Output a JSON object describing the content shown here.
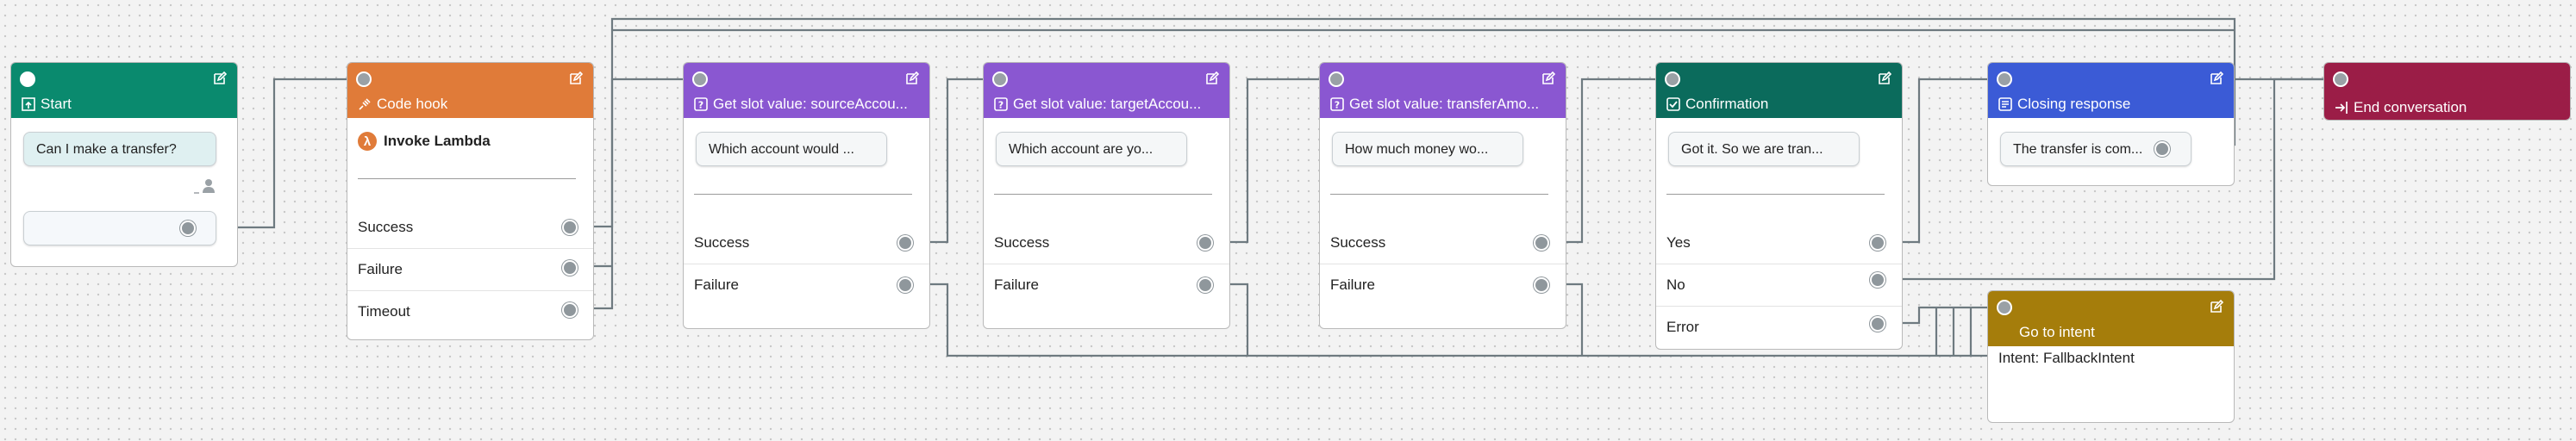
{
  "colors": {
    "start": "#0a8a6e",
    "codehook": "#e07b39",
    "slot": "#8a57d1",
    "confirmation": "#0b6b5c",
    "closing": "#3b5bd6",
    "end": "#9b1d47",
    "gotointent": "#a57d0b",
    "connector": "#6e7a80",
    "port": "#8f979c"
  },
  "start": {
    "title": "Start",
    "message": "Can I make a transfer?",
    "input_value": ""
  },
  "codehook": {
    "title": "Code hook",
    "lambda_label": "Invoke Lambda",
    "outputs": [
      "Success",
      "Failure",
      "Timeout"
    ]
  },
  "slot1": {
    "title": "Get slot value: sourceAccou...",
    "prompt": "Which account would ...",
    "outputs": [
      "Success",
      "Failure"
    ]
  },
  "slot2": {
    "title": "Get slot value: targetAccou...",
    "prompt": "Which account are yo...",
    "outputs": [
      "Success",
      "Failure"
    ]
  },
  "slot3": {
    "title": "Get slot value: transferAmo...",
    "prompt": "How much money wo...",
    "outputs": [
      "Success",
      "Failure"
    ]
  },
  "confirmation": {
    "title": "Confirmation",
    "prompt": "Got it. So we are tran...",
    "outputs": [
      "Yes",
      "No",
      "Error"
    ]
  },
  "closing": {
    "title": "Closing response",
    "prompt": "The transfer is com..."
  },
  "end": {
    "title": "End conversation"
  },
  "gotointent": {
    "title": "Go to intent",
    "intent_label": "Intent: FallbackIntent"
  },
  "icons": {
    "edit": "edit-icon",
    "start": "start-icon",
    "codehook": "plug-icon",
    "slot": "question-box-icon",
    "confirmation": "checkbox-icon",
    "closing": "message-box-icon",
    "end": "exit-icon",
    "lambda": "lambda-icon",
    "user": "user-icon"
  }
}
